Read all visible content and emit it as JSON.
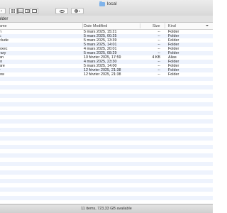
{
  "window": {
    "title": "local"
  },
  "toolbar": {
    "view_modes": [
      "icon",
      "list",
      "column",
      "cover-flow"
    ],
    "active_view": "list"
  },
  "pathbar": {
    "label": "older"
  },
  "columns": {
    "name": "ame",
    "date": "Date Modified",
    "size": "Size",
    "kind": "Kind"
  },
  "rows": [
    {
      "name": "n",
      "date": "5 mars 2025, 15:21",
      "size": "--",
      "kind": "Folder"
    },
    {
      "name": "c",
      "date": "5 mars 2025, 00:25",
      "size": "--",
      "kind": "Folder"
    },
    {
      "name": "clude",
      "date": "5 mars 2025, 13:39",
      "size": "--",
      "kind": "Folder"
    },
    {
      "name": "",
      "date": "5 mars 2025, 14:01",
      "size": "--",
      "kind": "Folder"
    },
    {
      "name": "exec",
      "date": "4 mars 2025, 20:01",
      "size": "--",
      "kind": "Folder"
    },
    {
      "name": "rary",
      "date": "5 mars 2025, 08:29",
      "size": "--",
      "kind": "Folder"
    },
    {
      "name": "an",
      "date": "10 février 2025, 17:59",
      "size": "4 KB",
      "kind": "Alias"
    },
    {
      "name": "in",
      "date": "4 mars 2025, 23:30",
      "size": "--",
      "kind": "Folder"
    },
    {
      "name": "are",
      "date": "5 mars 2025, 14:00",
      "size": "--",
      "kind": "Folder"
    },
    {
      "name": "r",
      "date": "12 février 2025, 21:38",
      "size": "--",
      "kind": "Folder"
    },
    {
      "name": "ew",
      "date": "12 février 2025, 21:38",
      "size": "--",
      "kind": "Folder"
    }
  ],
  "status": {
    "text": "11 items, 723,33 GB available"
  }
}
